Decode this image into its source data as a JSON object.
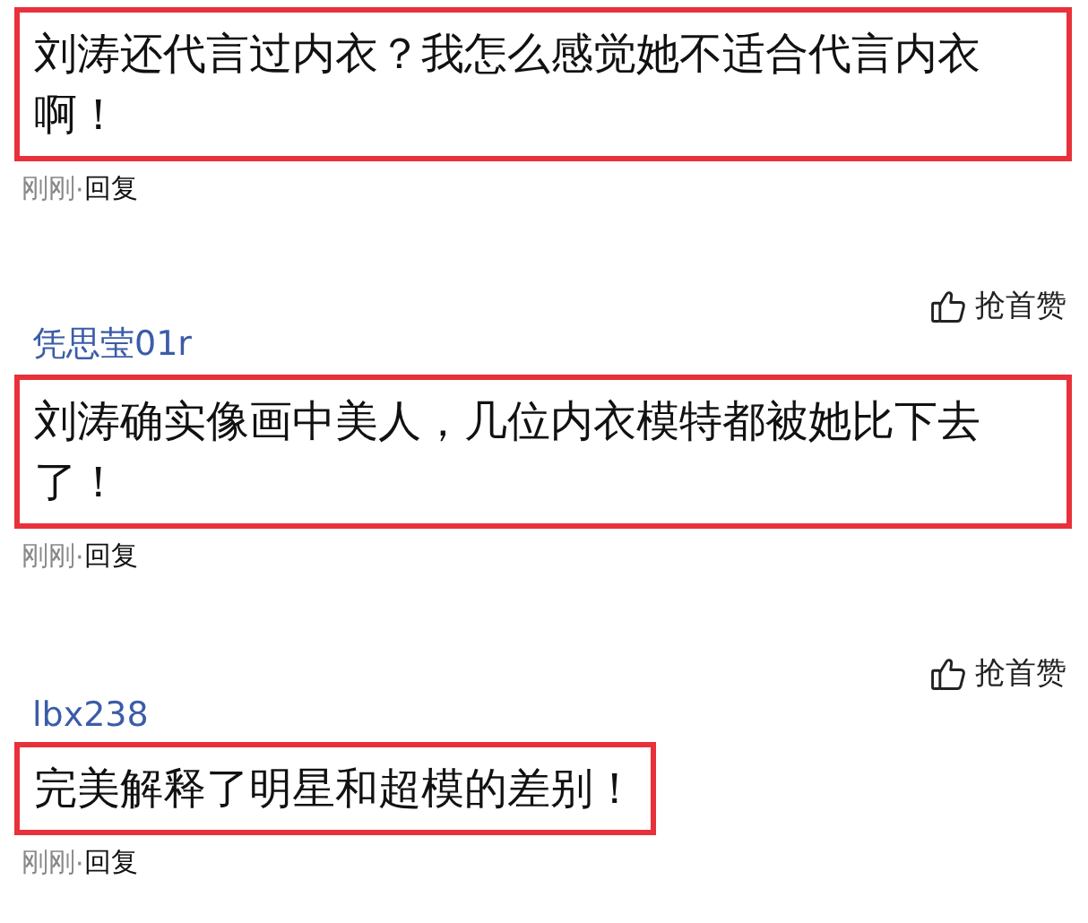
{
  "comments": [
    {
      "text": "刘涛还代言过内衣？我怎么感觉她不适合代言内衣啊！",
      "highlighted": true,
      "time": "刚刚",
      "separator": "·",
      "reply": "回复"
    },
    {
      "author": "凭思莹01r",
      "like_label": "抢首赞",
      "text": "刘涛确实像画中美人，几位内衣模特都被她比下去了！",
      "highlighted": true,
      "time": "刚刚",
      "separator": "·",
      "reply": "回复"
    },
    {
      "author": "lbx238",
      "like_label": "抢首赞",
      "text": "完美解释了明星和超模的差别！",
      "highlighted": true,
      "time": "刚刚",
      "separator": "·",
      "reply": "回复"
    }
  ]
}
